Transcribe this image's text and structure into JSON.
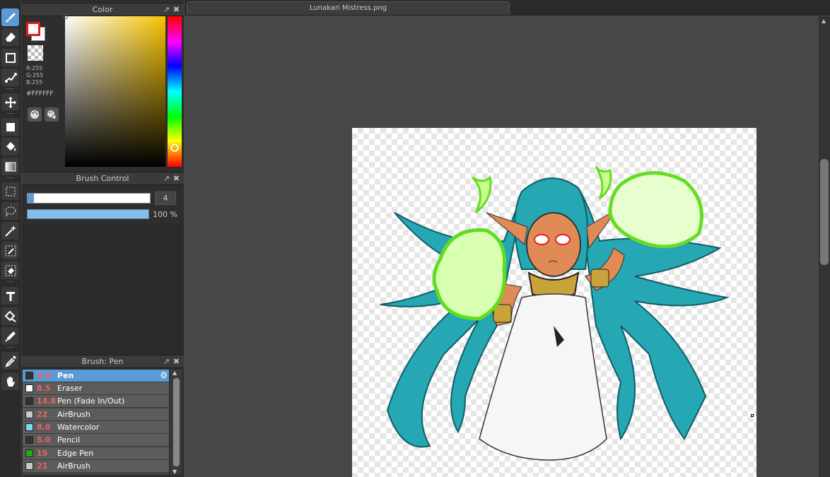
{
  "document": {
    "tab_title": "Lunakari Mistress.png"
  },
  "panels": {
    "color": {
      "title": "Color",
      "r": "R:255",
      "g": "G:255",
      "b": "B:255",
      "hex": "#FFFFFF",
      "foreground": "#FFFFFF",
      "foreground_border": "#E01C1C"
    },
    "brush_control": {
      "title": "Brush Control",
      "size": "4",
      "opacity": "100 %",
      "size_level_percent": 5,
      "opacity_level_percent": 100
    },
    "brush_list": {
      "title": "Brush: Pen",
      "items": [
        {
          "size": "4.0",
          "name": "Pen",
          "color": "#333333",
          "selected": true
        },
        {
          "size": "8.5",
          "name": "Eraser",
          "color": "#FFFFFF",
          "selected": false
        },
        {
          "size": "14.8",
          "name": "Pen (Fade In/Out)",
          "color": "#333333",
          "selected": false
        },
        {
          "size": "22",
          "name": "AirBrush",
          "color": "#C8C8C8",
          "selected": false
        },
        {
          "size": "8.0",
          "name": "Watercolor",
          "color": "#7FD8F0",
          "selected": false
        },
        {
          "size": "5.0",
          "name": "Pencil",
          "color": "#333333",
          "selected": false
        },
        {
          "size": "15",
          "name": "Edge Pen",
          "color": "#22AA22",
          "selected": false
        },
        {
          "size": "21",
          "name": "AirBrush",
          "color": "#C8C8C8",
          "selected": false
        }
      ]
    }
  },
  "tools": [
    "brush-icon",
    "eraser-icon",
    "shape-icon",
    "dot-brush-icon",
    "move-icon",
    "fill-rect-icon",
    "bucket-icon",
    "gradient-icon",
    "rect-select-icon",
    "lasso-icon",
    "magic-wand-icon",
    "select-pen-icon",
    "select-eraser-icon",
    "text-icon",
    "divide-icon",
    "eyedropper-icon",
    "pipette-icon",
    "hand-icon"
  ]
}
